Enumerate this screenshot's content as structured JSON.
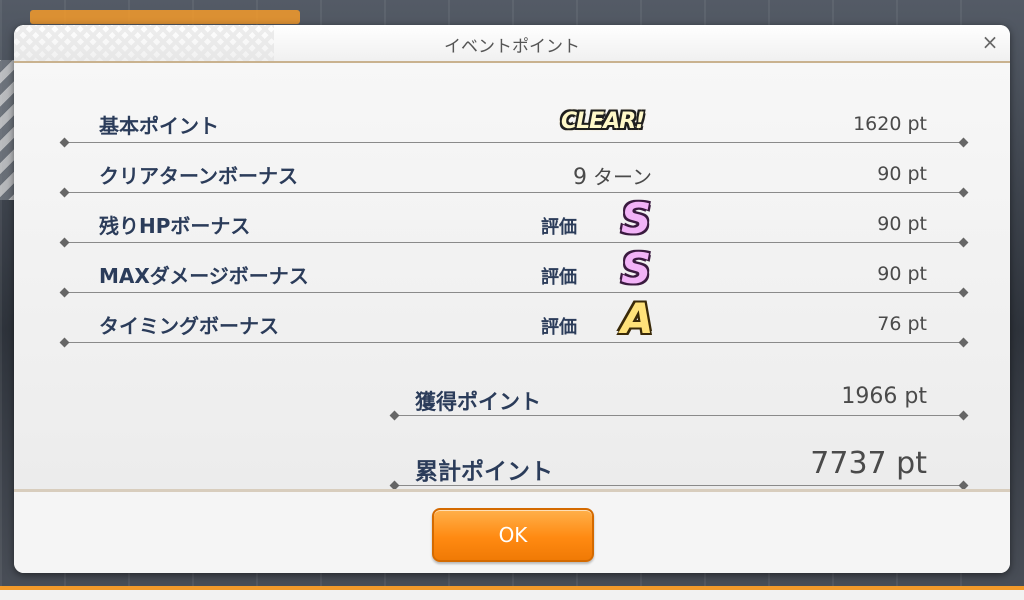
{
  "dialog": {
    "title": "イベントポイント",
    "close_glyph": "×",
    "ok_label": "OK"
  },
  "rows": [
    {
      "label": "基本ポイント",
      "badge": "CLEAR!",
      "points": "1620 pt"
    },
    {
      "label": "クリアターンボーナス",
      "turns_value": "9",
      "turns_unit": "ターン",
      "points": "90 pt"
    },
    {
      "label": "残りHPボーナス",
      "rank_text": "評価",
      "grade": "S",
      "points": "90 pt"
    },
    {
      "label": "MAXダメージボーナス",
      "rank_text": "評価",
      "grade": "S",
      "points": "90 pt"
    },
    {
      "label": "タイミングボーナス",
      "rank_text": "評価",
      "grade": "A",
      "points": "76 pt"
    }
  ],
  "summary": {
    "earned_label": "獲得ポイント",
    "earned_points": "1966 pt",
    "total_label": "累計ポイント",
    "total_points": "7737 pt"
  },
  "colors": {
    "accent": "#ff8a12",
    "label_text": "#2b3c5a",
    "grade_s": "#f2b3f7",
    "grade_a": "#ffe27a"
  }
}
